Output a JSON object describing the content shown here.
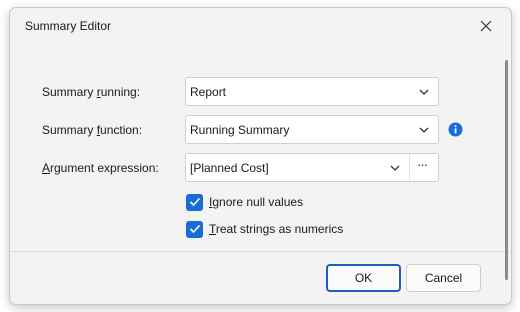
{
  "window": {
    "title": "Summary Editor"
  },
  "form": {
    "summary_running": {
      "label_pre": "Summary ",
      "label_u": "r",
      "label_post": "unning:",
      "value": "Report"
    },
    "summary_function": {
      "label_pre": "Summary ",
      "label_u": "f",
      "label_post": "unction:",
      "value": "Running Summary"
    },
    "argument_expression": {
      "label_pre": "",
      "label_u": "A",
      "label_post": "rgument expression:",
      "value": "[Planned Cost]",
      "ellipsis": "···"
    },
    "ignore_null": {
      "label_u": "I",
      "label_post": "gnore null values",
      "checked": true
    },
    "treat_strings": {
      "label_u": "T",
      "label_post": "reat strings as numerics",
      "checked": true
    }
  },
  "buttons": {
    "ok": "OK",
    "cancel": "Cancel"
  },
  "colors": {
    "accent": "#1a6dd6",
    "info": "#1a6dd6",
    "primary_border": "#1f5fb7"
  },
  "icons": {
    "close": "close-icon",
    "dropdown": "chevron-down-icon",
    "info": "info-icon",
    "check": "checkmark-icon"
  }
}
